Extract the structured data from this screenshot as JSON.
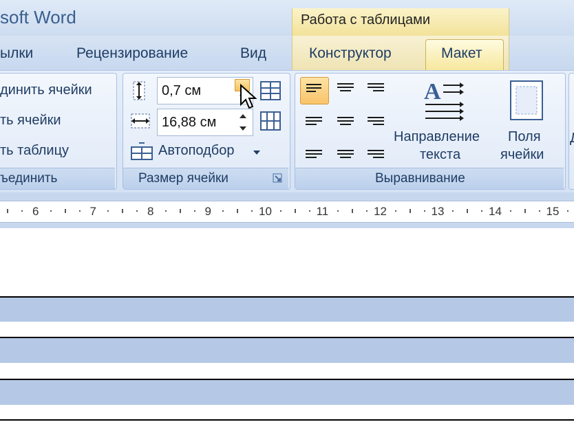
{
  "window": {
    "title": "soft Word"
  },
  "context_tab_header": "Работа с таблицами",
  "tabs": [
    {
      "label": "ылки"
    },
    {
      "label": "Рецензирование"
    },
    {
      "label": "Вид"
    },
    {
      "label": "Конструктор"
    },
    {
      "label": "Макет",
      "active": true
    }
  ],
  "ribbon": {
    "merge_group": {
      "buttons": [
        "динить ячейки",
        "ть ячейки",
        "ть таблицу"
      ],
      "label": "ъединить"
    },
    "cell_size_group": {
      "height_value": "0,7 см",
      "width_value": "16,88 см",
      "autofit_label": "Автоподбор",
      "label": "Размер ячейки"
    },
    "alignment_group": {
      "text_direction_label_1": "Направление",
      "text_direction_label_2": "текста",
      "cell_margins_label_1": "Поля",
      "cell_margins_label_2": "ячейки",
      "label": "Выравнивание",
      "selected_alignment": "top-left"
    },
    "cutoff_char": "Д"
  },
  "ruler": {
    "numbers": [
      "6",
      "7",
      "8",
      "9",
      "10",
      "11",
      "12",
      "13",
      "14",
      "15"
    ]
  },
  "colors": {
    "table_row_band": "#b5c8e6",
    "context_tab": "#f6e69b",
    "ribbon_text": "#1f3c64"
  }
}
